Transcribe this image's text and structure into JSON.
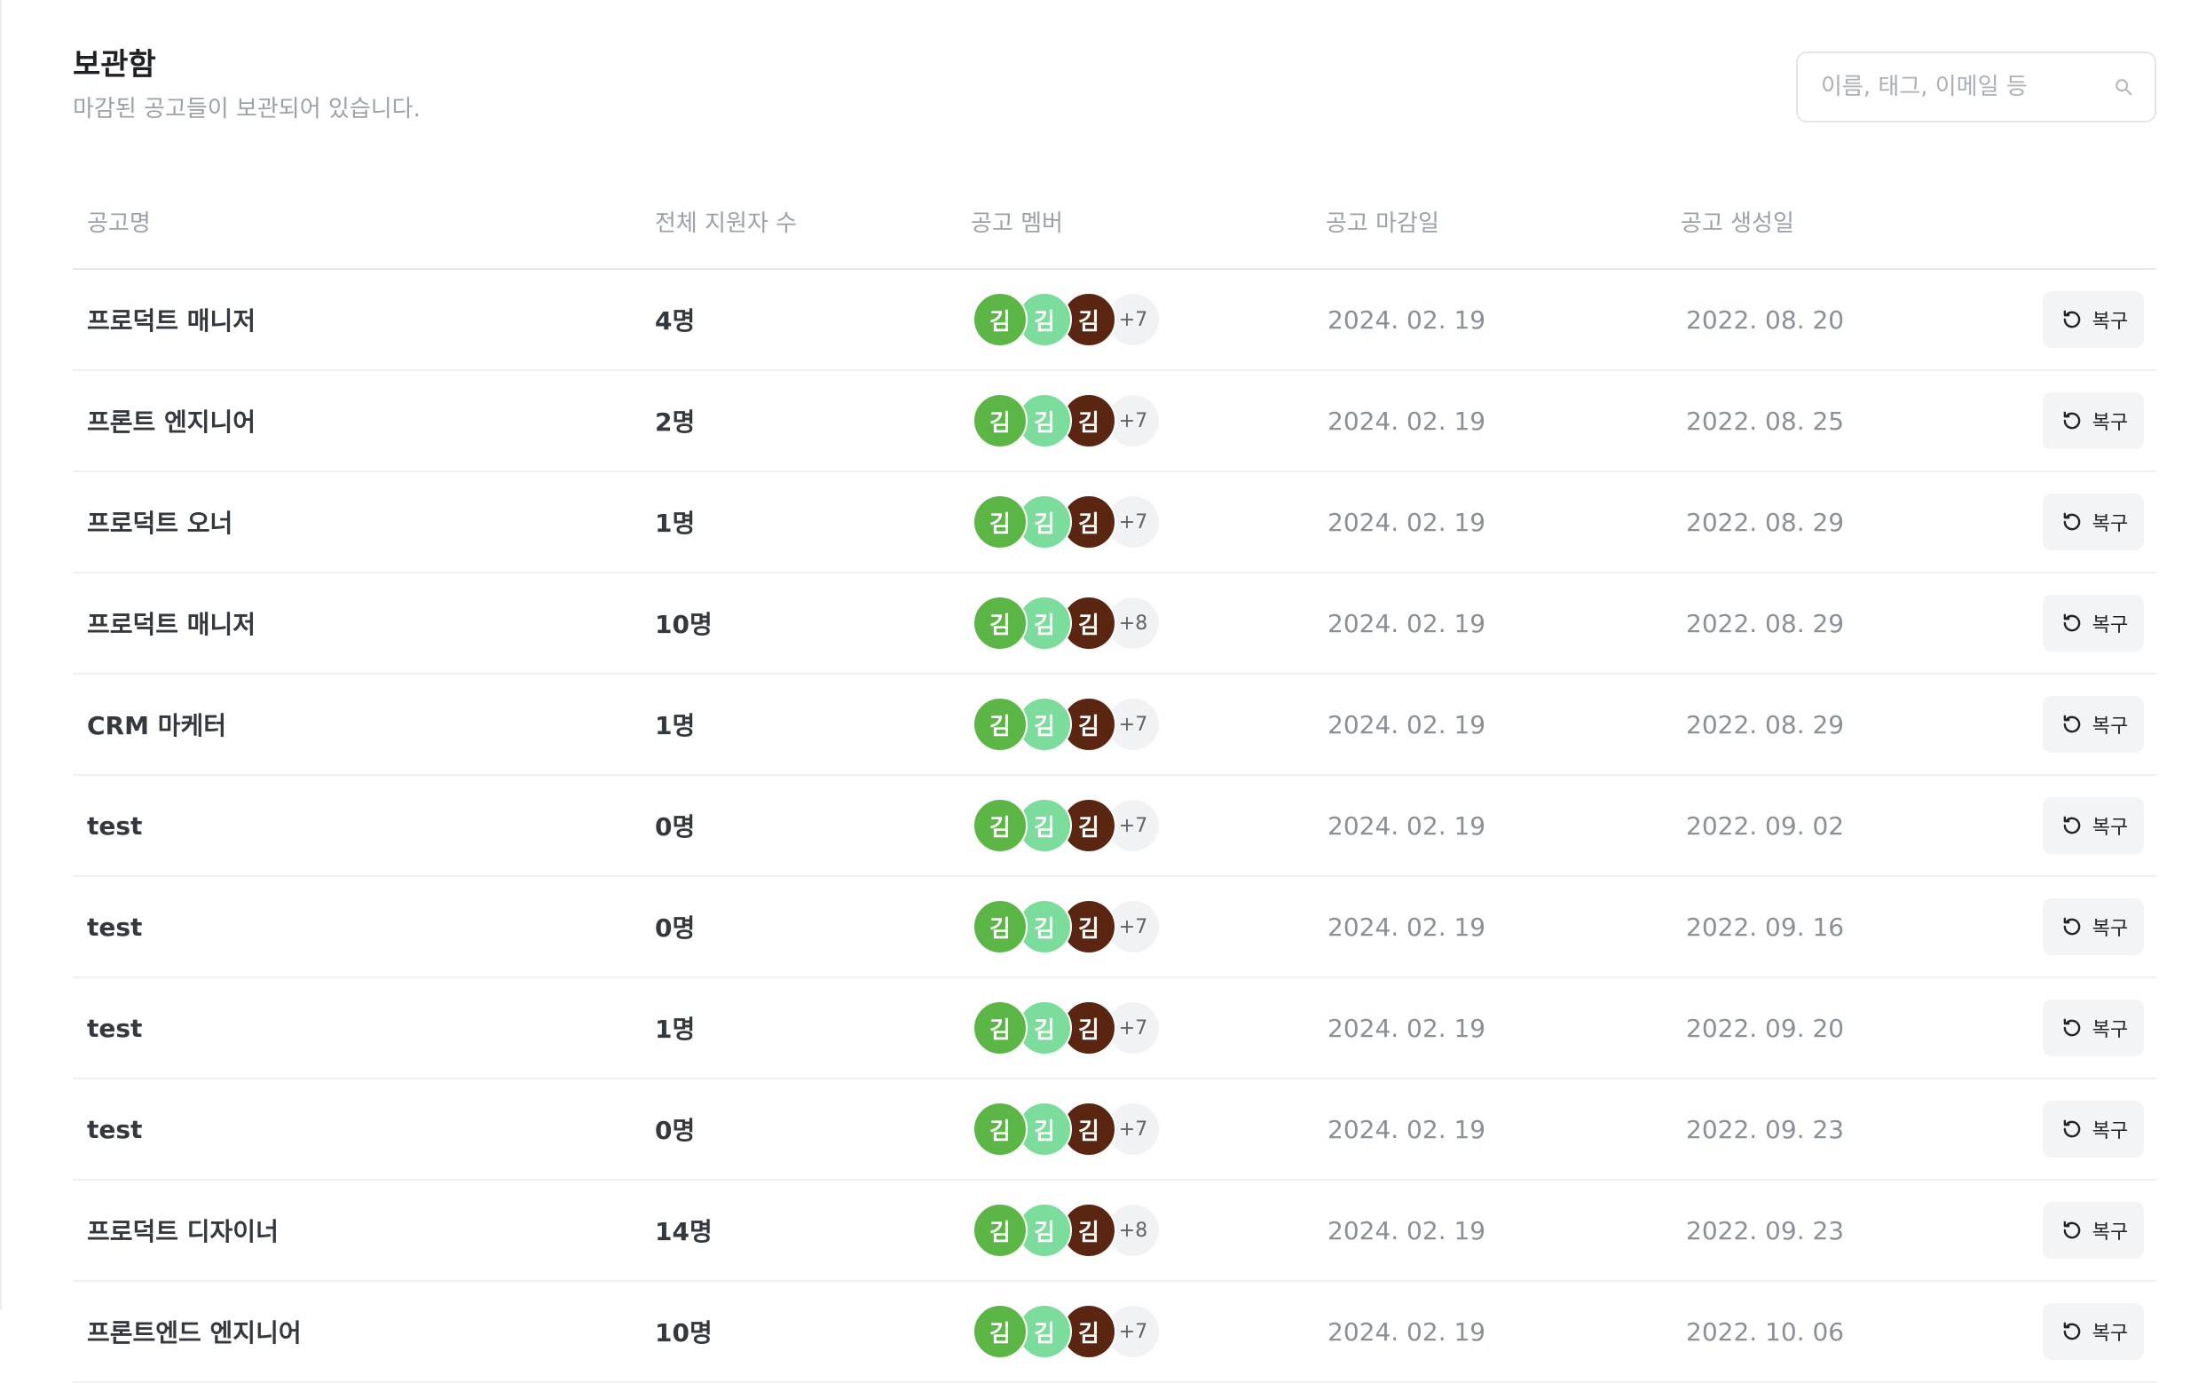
{
  "page": {
    "title": "보관함",
    "subtitle": "마감된 공고들이 보관되어 있습니다."
  },
  "search": {
    "placeholder": "이름, 태그, 이메일 등",
    "value": "",
    "icon": "search-icon"
  },
  "table": {
    "headers": {
      "name": "공고명",
      "applicants": "전체 지원자 수",
      "members": "공고 멤버",
      "deadline": "공고 마감일",
      "created": "공고 생성일"
    },
    "avatar_colors": [
      "#5cb646",
      "#7bdc9c",
      "#5a2612"
    ],
    "avatar_initial": "김",
    "restore_label": "복구",
    "rows": [
      {
        "name": "프로덕트 매니저",
        "applicants": "4명",
        "more": "+7",
        "deadline": "2024. 02. 19",
        "created": "2022. 08. 20"
      },
      {
        "name": "프론트 엔지니어",
        "applicants": "2명",
        "more": "+7",
        "deadline": "2024. 02. 19",
        "created": "2022. 08. 25"
      },
      {
        "name": "프로덕트 오너",
        "applicants": "1명",
        "more": "+7",
        "deadline": "2024. 02. 19",
        "created": "2022. 08. 29"
      },
      {
        "name": "프로덕트 매니저",
        "applicants": "10명",
        "more": "+8",
        "deadline": "2024. 02. 19",
        "created": "2022. 08. 29"
      },
      {
        "name": "CRM 마케터",
        "applicants": "1명",
        "more": "+7",
        "deadline": "2024. 02. 19",
        "created": "2022. 08. 29"
      },
      {
        "name": "test",
        "applicants": "0명",
        "more": "+7",
        "deadline": "2024. 02. 19",
        "created": "2022. 09. 02"
      },
      {
        "name": "test",
        "applicants": "0명",
        "more": "+7",
        "deadline": "2024. 02. 19",
        "created": "2022. 09. 16"
      },
      {
        "name": "test",
        "applicants": "1명",
        "more": "+7",
        "deadline": "2024. 02. 19",
        "created": "2022. 09. 20"
      },
      {
        "name": "test",
        "applicants": "0명",
        "more": "+7",
        "deadline": "2024. 02. 19",
        "created": "2022. 09. 23"
      },
      {
        "name": "프로덕트 디자이너",
        "applicants": "14명",
        "more": "+8",
        "deadline": "2024. 02. 19",
        "created": "2022. 09. 23"
      },
      {
        "name": "프론트엔드 엔지니어",
        "applicants": "10명",
        "more": "+7",
        "deadline": "2024. 02. 19",
        "created": "2022. 10. 06"
      }
    ]
  }
}
